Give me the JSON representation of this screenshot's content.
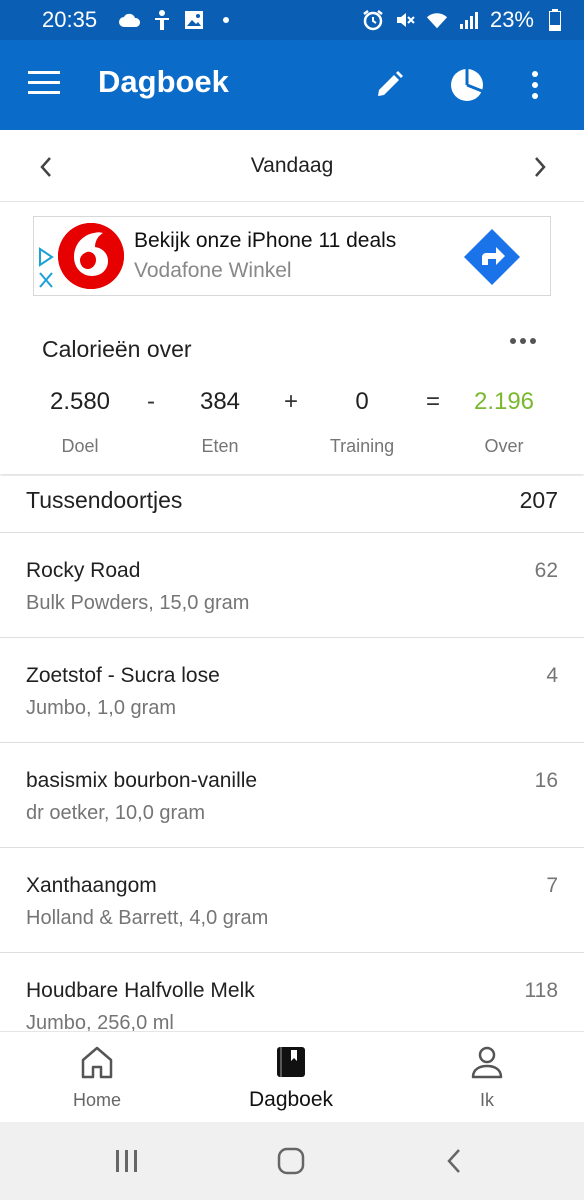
{
  "status_bar": {
    "time": "20:35",
    "battery": "23%",
    "icons": [
      "cloud-icon",
      "accessibility-icon",
      "image-icon",
      "dot-icon",
      "alarm-icon",
      "mute-icon",
      "wifi-icon",
      "signal-icon",
      "battery-icon"
    ]
  },
  "app_bar": {
    "title": "Dagboek",
    "actions": [
      "edit-icon",
      "pie-chart-icon",
      "overflow-menu-icon"
    ],
    "color": "#0b6bc9"
  },
  "date_nav": {
    "label": "Vandaag"
  },
  "ad": {
    "headline": "Bekijk onze iPhone 11 deals",
    "advertiser": "Vodafone Winkel"
  },
  "calories": {
    "title": "Calorieën over",
    "goal_value": "2.580",
    "goal_label": "Doel",
    "food_value": "384",
    "food_label": "Eten",
    "exercise_value": "0",
    "exercise_label": "Training",
    "remaining_value": "2.196",
    "remaining_label": "Over",
    "op_minus": "-",
    "op_plus": "+",
    "op_equals": "=",
    "remaining_color": "#7ab92e"
  },
  "meal": {
    "title": "Tussendoortjes",
    "calories": "207",
    "items": [
      {
        "name": "Rocky Road",
        "desc": "Bulk Powders, 15,0 gram",
        "cal": "62"
      },
      {
        "name": "Zoetstof - Sucra lose",
        "desc": "Jumbo, 1,0 gram",
        "cal": "4"
      },
      {
        "name": "basismix bourbon-vanille",
        "desc": "dr oetker, 10,0 gram",
        "cal": "16"
      },
      {
        "name": "Xanthaangom",
        "desc": "Holland & Barrett, 4,0 gram",
        "cal": "7"
      },
      {
        "name": "Houdbare Halfvolle Melk",
        "desc": "Jumbo, 256,0 ml",
        "cal": "118"
      }
    ]
  },
  "bottom_nav": {
    "home": "Home",
    "diary": "Dagboek",
    "me": "Ik"
  }
}
